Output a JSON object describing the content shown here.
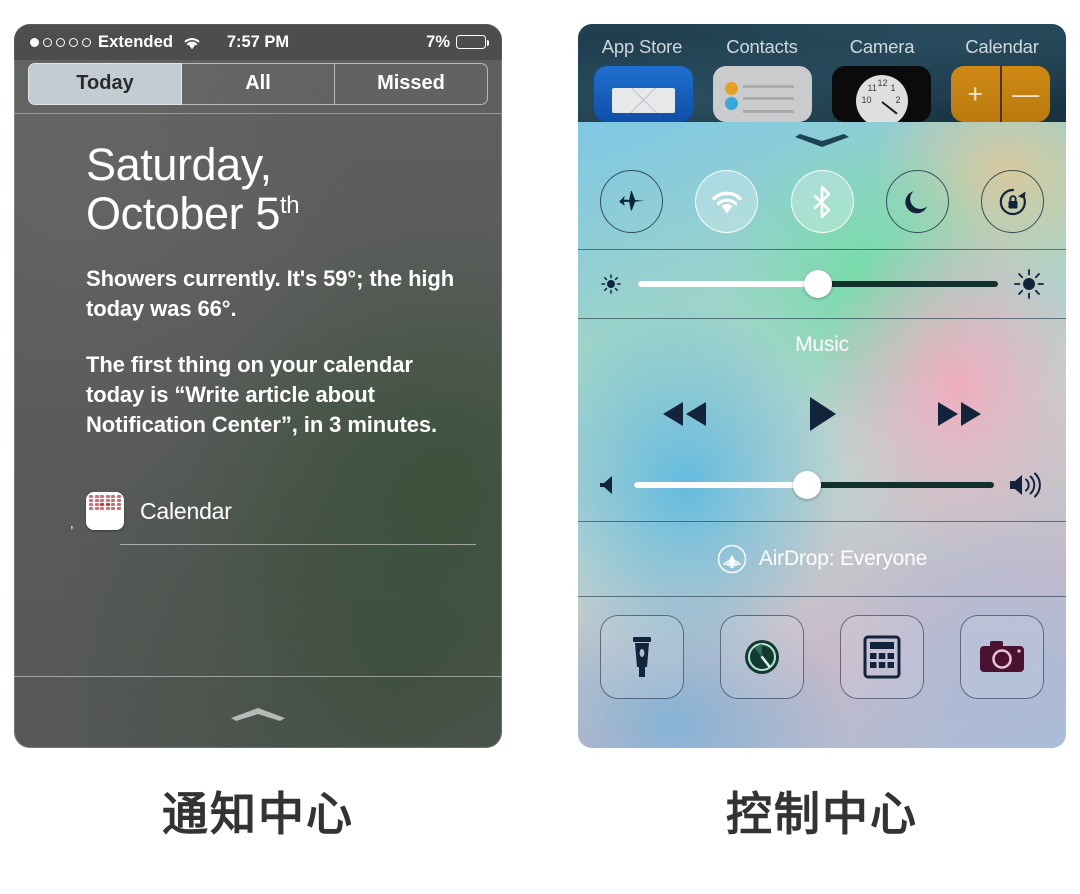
{
  "notification_center": {
    "status_bar": {
      "signal_dots_total": 5,
      "signal_dots_filled": 1,
      "carrier": "Extended",
      "wifi_icon": "wifi-icon",
      "time": "7:57 PM",
      "battery_percent": "7%",
      "battery_level": 7,
      "battery_color": "#ef3b2d"
    },
    "tabs": [
      {
        "label": "Today",
        "active": true
      },
      {
        "label": "All",
        "active": false
      },
      {
        "label": "Missed",
        "active": false
      }
    ],
    "date_line1": "Saturday,",
    "date_line2": "October 5",
    "date_ordinal": "th",
    "weather_text": "Showers currently. It's 59°; the high today was 66°.",
    "calendar_text": "The first thing on your calendar today is “Write article about Notification Center”, in 3 minutes.",
    "app_section": {
      "icon": "calendar-app-icon",
      "name": "Calendar",
      "tick_mark": "’"
    },
    "grabber_icon": "chevron-up-grabber"
  },
  "control_center": {
    "home_screen": {
      "app_labels": [
        "App Store",
        "Contacts",
        "Camera",
        "Calendar"
      ],
      "app_icons": [
        "mail-icon",
        "contacts-icon",
        "clock-icon",
        "calculator-icon"
      ],
      "calculator_plus": "+",
      "calculator_minus": "—",
      "clock_numbers": [
        "10",
        "11",
        "12",
        "1",
        "2"
      ]
    },
    "grabber_icon": "chevron-down-grabber",
    "toggles": [
      {
        "name": "airplane-mode",
        "icon": "airplane-icon",
        "state": "off"
      },
      {
        "name": "wifi",
        "icon": "wifi-icon",
        "state": "on"
      },
      {
        "name": "bluetooth",
        "icon": "bluetooth-icon",
        "state": "on"
      },
      {
        "name": "do-not-disturb",
        "icon": "moon-icon",
        "state": "off"
      },
      {
        "name": "rotation-lock",
        "icon": "rotation-lock-icon",
        "state": "off"
      }
    ],
    "brightness": {
      "icon_low": "sun-small-icon",
      "icon_high": "sun-large-icon",
      "value": 50
    },
    "music": {
      "title": "Music",
      "controls": [
        "rewind-icon",
        "play-icon",
        "fast-forward-icon"
      ],
      "volume": {
        "icon_low": "speaker-mute-icon",
        "icon_high": "speaker-loud-icon",
        "value": 48
      }
    },
    "airdrop": {
      "icon": "airdrop-icon",
      "label": "AirDrop: Everyone"
    },
    "shortcuts": [
      {
        "name": "flashlight",
        "icon": "flashlight-icon"
      },
      {
        "name": "timer",
        "icon": "timer-icon"
      },
      {
        "name": "calculator",
        "icon": "calculator-icon"
      },
      {
        "name": "camera",
        "icon": "camera-icon"
      }
    ]
  },
  "captions": {
    "left": "通知中心",
    "right": "控制中心"
  }
}
